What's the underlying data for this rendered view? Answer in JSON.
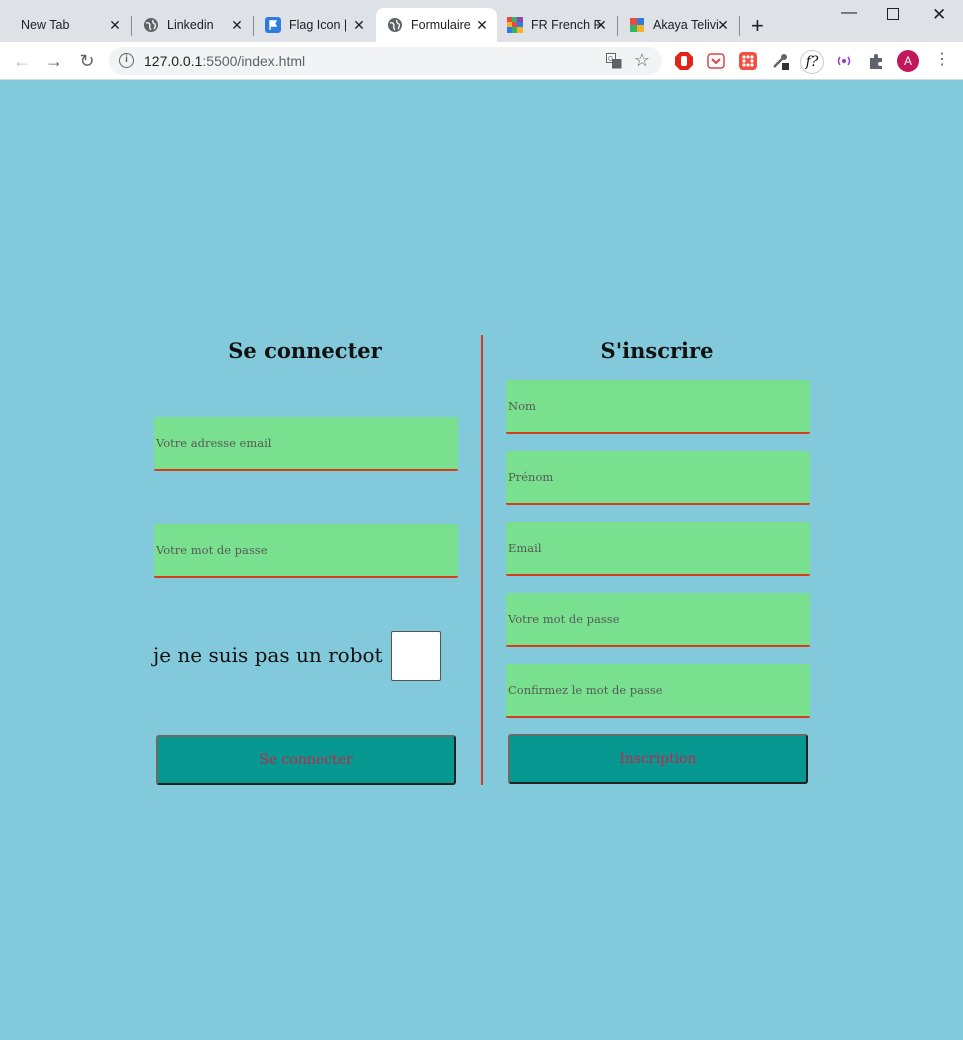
{
  "browser": {
    "tabs": [
      {
        "title": "New Tab",
        "icon": "none",
        "active": false
      },
      {
        "title": "Linkedin",
        "icon": "globe-icon",
        "active": false
      },
      {
        "title": "Flag Icon |",
        "icon": "flag-icon",
        "active": false
      },
      {
        "title": "Formulaire",
        "icon": "globe-icon",
        "active": true
      },
      {
        "title": "FR French F",
        "icon": "grid-icon",
        "active": false
      },
      {
        "title": "Akaya Telivi",
        "icon": "pinwheel-icon",
        "active": false
      }
    ],
    "url_host": "127.0.0.1",
    "url_rest": ":5500/index.html",
    "profile_initial": "A",
    "ext_f_label": "f?"
  },
  "login": {
    "title": "Se connecter",
    "email_placeholder": "Votre adresse email",
    "password_placeholder": "Votre mot de passe",
    "robot_label": "je ne suis pas un robot",
    "submit_label": "Se connecter"
  },
  "signup": {
    "title": "S'inscrire",
    "nom_placeholder": "Nom",
    "prenom_placeholder": "Prénom",
    "email_placeholder": "Email",
    "password_placeholder": "Votre mot de passe",
    "confirm_placeholder": "Confirmez le mot de passe",
    "submit_label": "Inscription"
  },
  "colors": {
    "page_bg": "#82cadb",
    "field_bg": "#79e08f",
    "accent_red": "#d43d1a",
    "button_bg": "#079891",
    "button_text": "#c2274a"
  }
}
